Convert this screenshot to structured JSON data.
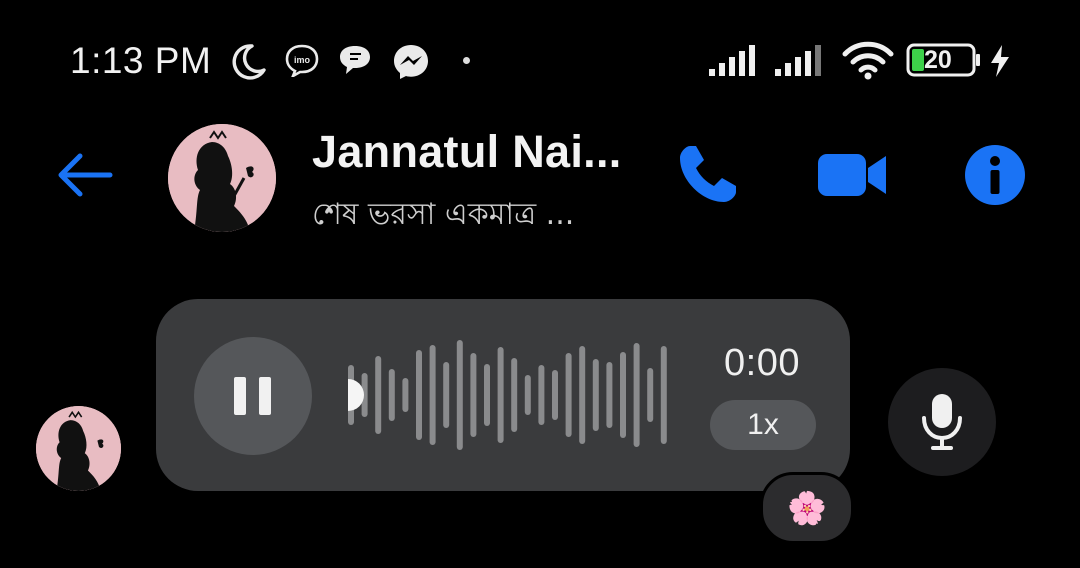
{
  "status_bar": {
    "time": "1:13 PM",
    "icons": [
      "moon-icon",
      "imo-icon",
      "chat-bubble-icon",
      "messenger-icon"
    ],
    "battery_level": "20"
  },
  "header": {
    "contact_name": "Jannatul Nai...",
    "contact_status": "শেষ ভরসা একমাত্র ...",
    "accent_color": "#1a73f5"
  },
  "voice_message": {
    "duration": "0:00",
    "playback_speed": "1x",
    "state": "playing",
    "progress": 0,
    "reaction": "🌸"
  }
}
